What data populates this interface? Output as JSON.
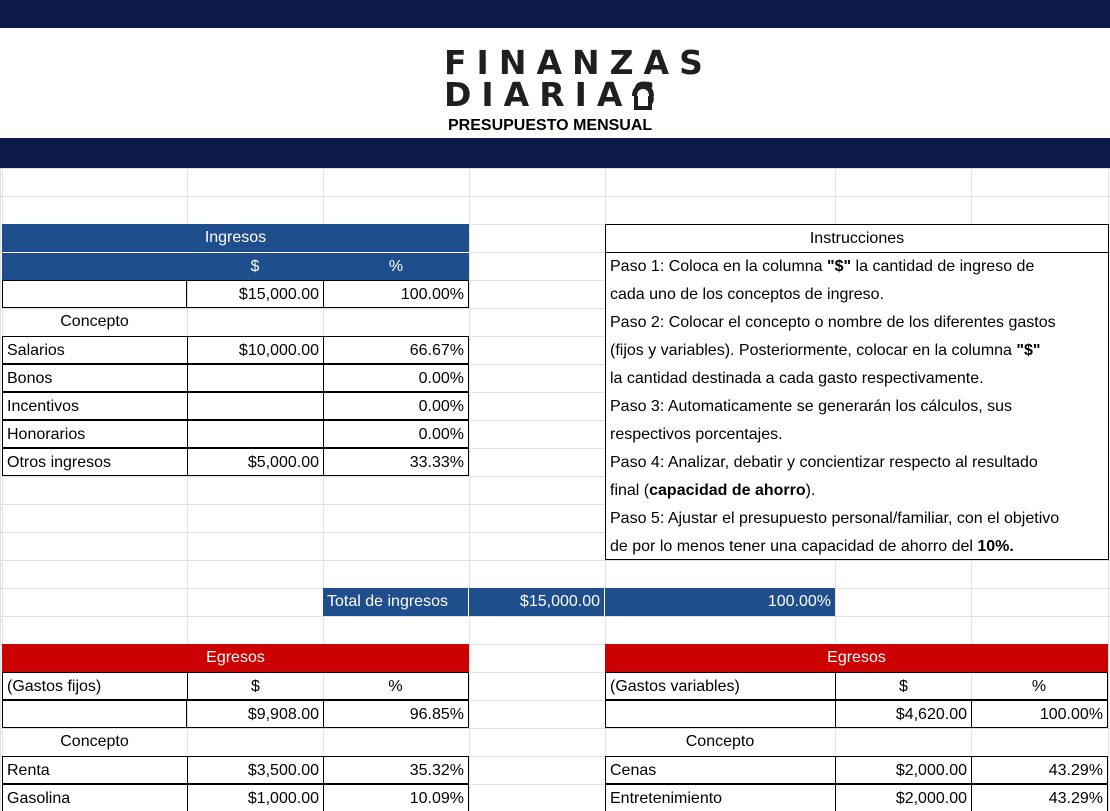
{
  "header": {
    "logo_line1": "FINANZAS",
    "logo_line2": "DIARIAS",
    "subtitle": "PRESUPUESTO MENSUAL"
  },
  "ingresos": {
    "title": "Ingresos",
    "col_amount": "$",
    "col_pct": "%",
    "total_amount": "$15,000.00",
    "total_pct": "100.00%",
    "concept_label": "Concepto",
    "rows": [
      {
        "name": "Salarios",
        "amount": "$10,000.00",
        "pct": "66.67%"
      },
      {
        "name": "Bonos",
        "amount": "",
        "pct": "0.00%"
      },
      {
        "name": "Incentivos",
        "amount": "",
        "pct": "0.00%"
      },
      {
        "name": "Honorarios",
        "amount": "",
        "pct": "0.00%"
      },
      {
        "name": "Otros ingresos",
        "amount": "$5,000.00",
        "pct": "33.33%"
      }
    ]
  },
  "instrucciones": {
    "title": "Instrucciones",
    "lines": [
      {
        "a": "Paso 1: Coloca en la columna ",
        "b": "\"$\"",
        "c": " la cantidad de ingreso de"
      },
      {
        "a": "cada uno de los conceptos de ingreso."
      },
      {
        "a": "Paso 2: Colocar el concepto o nombre de los diferentes gastos"
      },
      {
        "a": "(fijos y variables). Posteriormente, colocar en la columna ",
        "b": "\"$\""
      },
      {
        "a": "la cantidad destinada a cada gasto respectivamente."
      },
      {
        "a": "Paso 3: Automaticamente se generarán los cálculos, sus"
      },
      {
        "a": "respectivos porcentajes."
      },
      {
        "a": "Paso 4: Analizar, debatir y concientizar respecto al resultado"
      },
      {
        "a": "final (",
        "b": "capacidad de ahorro",
        "c": ")."
      },
      {
        "a": "Paso 5:  Ajustar el presupuesto personal/familiar, con el objetivo"
      },
      {
        "a": "de por lo menos tener una capacidad de ahorro del ",
        "b": "10%."
      }
    ]
  },
  "total_ingresos": {
    "label": "Total de ingresos",
    "amount": "$15,000.00",
    "pct": "100.00%"
  },
  "egresos_fijos": {
    "title": "Egresos",
    "subtitle": "(Gastos fijos)",
    "col_amount": "$",
    "col_pct": "%",
    "total_amount": "$9,908.00",
    "total_pct": "96.85%",
    "concept_label": "Concepto",
    "rows": [
      {
        "name": "Renta",
        "amount": "$3,500.00",
        "pct": "35.32%"
      },
      {
        "name": "Gasolina",
        "amount": "$1,000.00",
        "pct": "10.09%"
      }
    ]
  },
  "egresos_variables": {
    "title": "Egresos",
    "subtitle": "(Gastos variables)",
    "col_amount": "$",
    "col_pct": "%",
    "total_amount": "$4,620.00",
    "total_pct": "100.00%",
    "concept_label": "Concepto",
    "rows": [
      {
        "name": "Cenas",
        "amount": "$2,000.00",
        "pct": "43.29%"
      },
      {
        "name": "Entretenimiento",
        "amount": "$2,000.00",
        "pct": "43.29%"
      }
    ]
  },
  "colors": {
    "navy": "#0c1a4a",
    "blue_header": "#1f4e8c",
    "red_header": "#cc0000"
  }
}
